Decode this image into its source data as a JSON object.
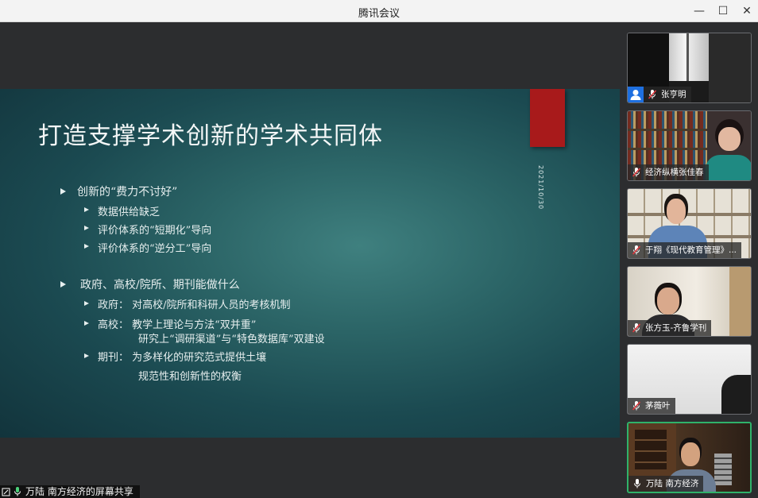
{
  "window": {
    "title": "腾讯会议",
    "minimize": "—",
    "maximize": "☐",
    "close": "✕"
  },
  "slide": {
    "title": "打造支撑学术创新的学术共同体",
    "date": "2021/10/30",
    "bullets": [
      "创新的“费力不讨好”",
      "数据供给缺乏",
      "评价体系的“短期化”导向",
      "评价体系的“逆分工”导向",
      "政府、高校/院所、期刊能做什么",
      "政府：  对高校/院所和科研人员的考核机制",
      "高校：  教学上理论与方法“双并重”",
      "研究上“调研渠道”与“特色数据库”双建设",
      "期刊：  为多样化的研究范式提供土壤",
      "规范性和创新性的权衡"
    ]
  },
  "participants": [
    {
      "name": "张亨明"
    },
    {
      "name": "经济纵横张佳春"
    },
    {
      "name": "于翔《现代教育管理》..."
    },
    {
      "name": "张方玉-齐鲁学刊"
    },
    {
      "name": "茅薇叶"
    },
    {
      "name": "万陆 南方经济"
    }
  ],
  "share_bar": {
    "label": "万陆 南方经济的屏幕共享"
  },
  "colors": {
    "accent": "#2fb26a",
    "slide_red": "#a81a1b",
    "avatar_blue": "#1e6fe0"
  }
}
